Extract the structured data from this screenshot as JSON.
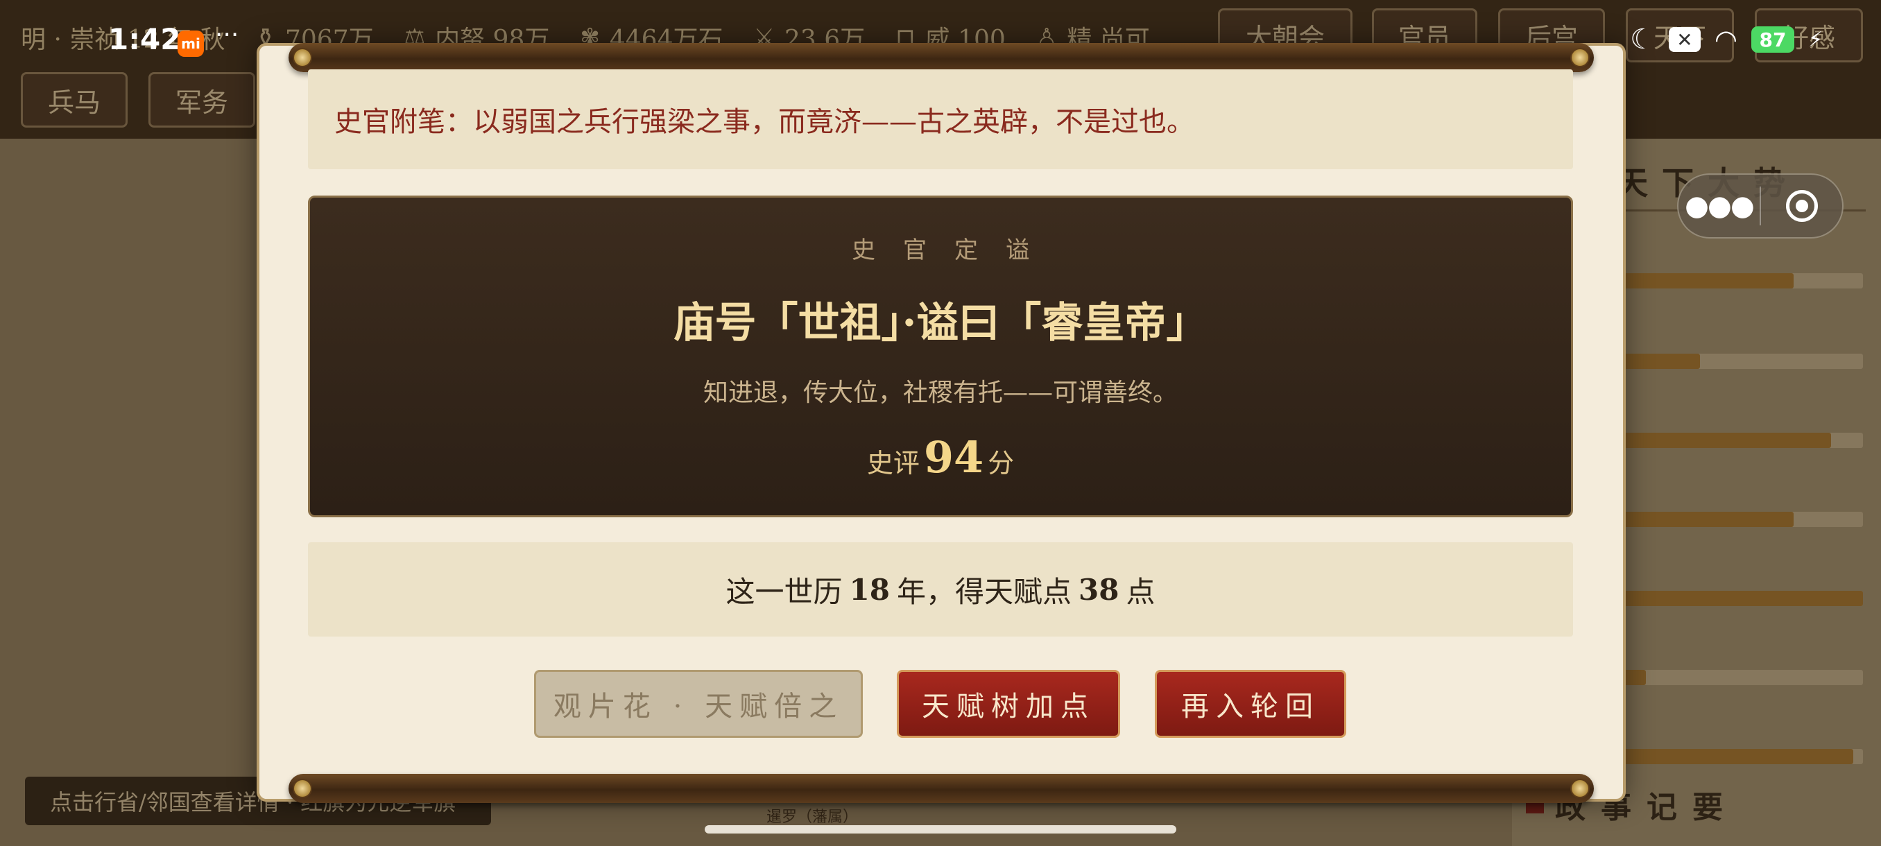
{
  "background": {
    "stats": [
      {
        "icon": "",
        "label": "明 · 崇祯 12 年 秋"
      },
      {
        "icon": "coin-bag-icon",
        "label": "7067万"
      },
      {
        "icon": "treasury-icon",
        "label": "内帑 98万"
      },
      {
        "icon": "grain-icon",
        "label": "4464万石"
      },
      {
        "icon": "troops-icon",
        "label": "23.6万"
      },
      {
        "icon": "lock-icon",
        "label": "威 100"
      },
      {
        "icon": "person-icon",
        "label": "精 尚可"
      }
    ],
    "top_buttons": [
      "大朝会",
      "官员",
      "后宫",
      "天下",
      "好感"
    ],
    "row2_buttons": [
      "兵马",
      "军务"
    ],
    "map_hint": "点击行省/邻国查看详情 · 红旗为元逆军旗",
    "map_region_label": "暹罗（藩属）",
    "side_title": "天下大势",
    "side_bars": [
      0.72,
      0.34,
      0.87,
      0.72,
      1.0,
      0.12,
      0.96
    ],
    "side_footer": "政事记要"
  },
  "status_bar": {
    "time": "1:42",
    "mi_badge": "mi",
    "dots": "···",
    "battery": "87"
  },
  "dialog": {
    "note": "史官附笔：以弱国之兵行强梁之事，而竟济——古之英辟，不是过也。",
    "verdict": {
      "heading": "史官定谥",
      "title": "庙号「世祖」·谥曰「睿皇帝」",
      "subtitle": "知进退，传大位，社稷有托——可谓善终。",
      "score_prefix": "史评",
      "score": "94",
      "score_suffix": "分"
    },
    "summary": {
      "prefix": "这一世历",
      "years": "18",
      "mid": "年，得天赋点",
      "points": "38",
      "suffix": "点"
    },
    "buttons": {
      "ad": "观片花 · 天赋倍之",
      "talent": "天赋树加点",
      "rebirth": "再入轮回"
    }
  },
  "colors": {
    "accent_red": "#a8281e",
    "gold": "#f4d68a",
    "parchment": "#f4ecdb",
    "dark_panel": "#2c2016"
  }
}
